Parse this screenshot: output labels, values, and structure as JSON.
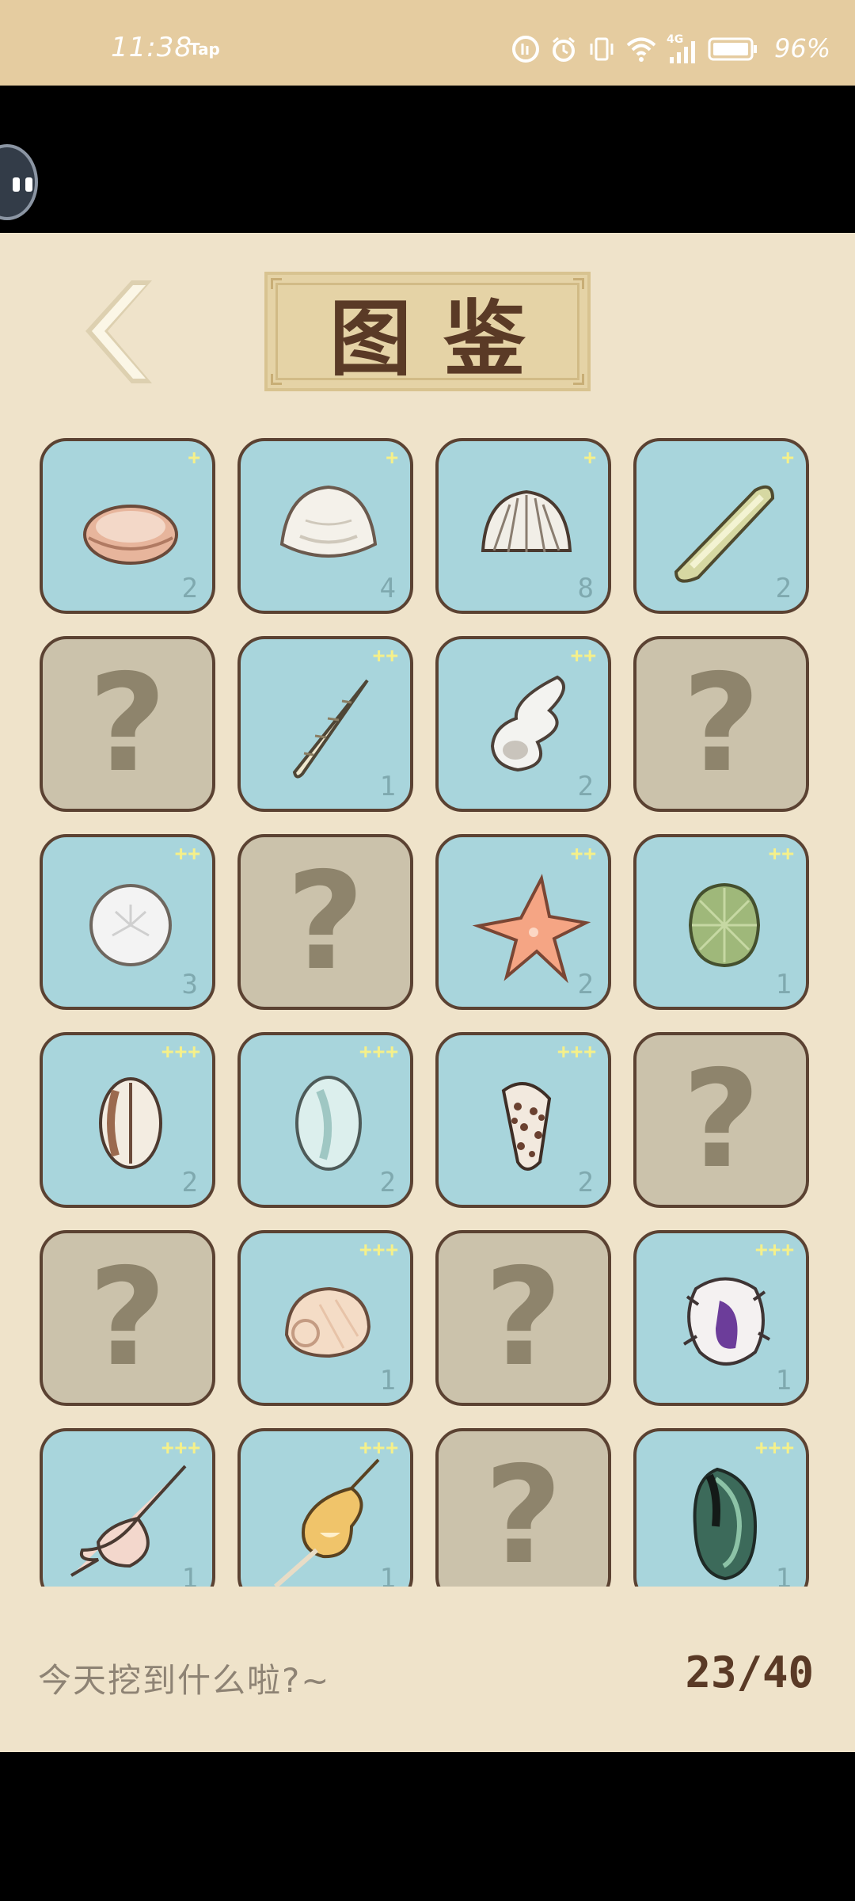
{
  "status_bar": {
    "time": "11:38",
    "app_badge": "Tap",
    "network": "4G",
    "battery_percent": "96%",
    "icons": [
      "data-saver-icon",
      "alarm-icon",
      "vibrate-icon",
      "wifi-icon",
      "signal-icon",
      "battery-icon"
    ]
  },
  "header": {
    "title": "图鉴",
    "back_icon": "chevron-left-icon"
  },
  "collection": {
    "items": [
      {
        "state": "found",
        "icon": "clam-shell-icon",
        "rarity": "+",
        "count": "2"
      },
      {
        "state": "found",
        "icon": "white-clam-icon",
        "rarity": "+",
        "count": "4"
      },
      {
        "state": "found",
        "icon": "cockle-shell-icon",
        "rarity": "+",
        "count": "8"
      },
      {
        "state": "found",
        "icon": "razor-clam-icon",
        "rarity": "+",
        "count": "2"
      },
      {
        "state": "locked",
        "icon": "unknown-icon",
        "rarity": "",
        "count": "",
        "placeholder": "?"
      },
      {
        "state": "found",
        "icon": "auger-shell-icon",
        "rarity": "++",
        "count": "1"
      },
      {
        "state": "found",
        "icon": "wentletrap-shell-icon",
        "rarity": "++",
        "count": "2"
      },
      {
        "state": "locked",
        "icon": "unknown-icon",
        "rarity": "",
        "count": "",
        "placeholder": "?"
      },
      {
        "state": "found",
        "icon": "sand-dollar-icon",
        "rarity": "++",
        "count": "3"
      },
      {
        "state": "locked",
        "icon": "unknown-icon",
        "rarity": "",
        "count": "",
        "placeholder": "?"
      },
      {
        "state": "found",
        "icon": "starfish-icon",
        "rarity": "++",
        "count": "2"
      },
      {
        "state": "found",
        "icon": "sea-urchin-icon",
        "rarity": "++",
        "count": "1"
      },
      {
        "state": "found",
        "icon": "cowrie-brown-icon",
        "rarity": "+++",
        "count": "2"
      },
      {
        "state": "found",
        "icon": "cowrie-pale-icon",
        "rarity": "+++",
        "count": "2"
      },
      {
        "state": "found",
        "icon": "cone-shell-icon",
        "rarity": "+++",
        "count": "2"
      },
      {
        "state": "locked",
        "icon": "unknown-icon",
        "rarity": "",
        "count": "",
        "placeholder": "?"
      },
      {
        "state": "locked",
        "icon": "unknown-icon",
        "rarity": "",
        "count": "",
        "placeholder": "?"
      },
      {
        "state": "found",
        "icon": "moon-snail-icon",
        "rarity": "+++",
        "count": "1"
      },
      {
        "state": "locked",
        "icon": "unknown-icon",
        "rarity": "",
        "count": "",
        "placeholder": "?"
      },
      {
        "state": "found",
        "icon": "purple-murex-icon",
        "rarity": "+++",
        "count": "1"
      },
      {
        "state": "found",
        "icon": "spindle-shell-icon",
        "rarity": "+++",
        "count": "1"
      },
      {
        "state": "found",
        "icon": "golden-conch-icon",
        "rarity": "+++",
        "count": "1"
      },
      {
        "state": "locked",
        "icon": "unknown-icon",
        "rarity": "",
        "count": "",
        "placeholder": "?"
      },
      {
        "state": "found",
        "icon": "mussel-icon",
        "rarity": "+++",
        "count": "1"
      }
    ]
  },
  "footer": {
    "hint": "今天挖到什么啦?~",
    "progress": "23/40"
  },
  "colors": {
    "card_found": "#a8d5dc",
    "card_locked": "#cbc2ab",
    "card_border": "#5b4232",
    "panel_bg": "#efe3ca",
    "status_bar_bg": "#e5cca0",
    "title_text": "#5a3a26"
  }
}
